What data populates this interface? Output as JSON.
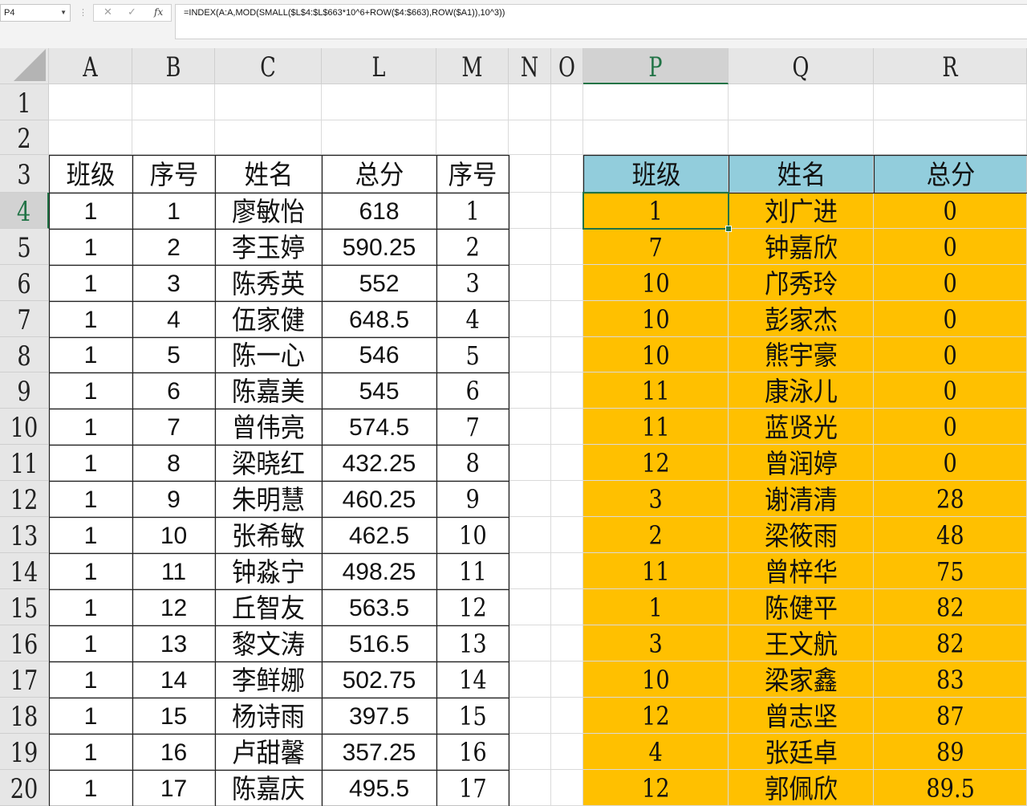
{
  "formula_bar": {
    "name_box": "P4",
    "cancel_icon": "✕",
    "enter_icon": "✓",
    "fx_label": "fx",
    "formula": "=INDEX(A:A,MOD(SMALL($L$4:$L$663*10^6+ROW($4:$663),ROW($A1)),10^3))"
  },
  "columns": [
    "A",
    "B",
    "C",
    "L",
    "M",
    "N",
    "O",
    "P",
    "Q",
    "R"
  ],
  "rows": [
    "1",
    "2",
    "3",
    "4",
    "5",
    "6",
    "7",
    "8",
    "9",
    "10",
    "11",
    "12",
    "13",
    "14",
    "15",
    "16",
    "17",
    "18",
    "19",
    "20"
  ],
  "selected_cell": "P4",
  "left_table": {
    "headers": [
      "班级",
      "序号",
      "姓名",
      "总分",
      "序号"
    ],
    "rows": [
      [
        "1",
        "1",
        "廖敏怡",
        "618",
        "1"
      ],
      [
        "1",
        "2",
        "李玉婷",
        "590.25",
        "2"
      ],
      [
        "1",
        "3",
        "陈秀英",
        "552",
        "3"
      ],
      [
        "1",
        "4",
        "伍家健",
        "648.5",
        "4"
      ],
      [
        "1",
        "5",
        "陈一心",
        "546",
        "5"
      ],
      [
        "1",
        "6",
        "陈嘉美",
        "545",
        "6"
      ],
      [
        "1",
        "7",
        "曾伟亮",
        "574.5",
        "7"
      ],
      [
        "1",
        "8",
        "梁晓红",
        "432.25",
        "8"
      ],
      [
        "1",
        "9",
        "朱明慧",
        "460.25",
        "9"
      ],
      [
        "1",
        "10",
        "张希敏",
        "462.5",
        "10"
      ],
      [
        "1",
        "11",
        "钟淼宁",
        "498.25",
        "11"
      ],
      [
        "1",
        "12",
        "丘智友",
        "563.5",
        "12"
      ],
      [
        "1",
        "13",
        "黎文涛",
        "516.5",
        "13"
      ],
      [
        "1",
        "14",
        "李鲜娜",
        "502.75",
        "14"
      ],
      [
        "1",
        "15",
        "杨诗雨",
        "397.5",
        "15"
      ],
      [
        "1",
        "16",
        "卢甜馨",
        "357.25",
        "16"
      ],
      [
        "1",
        "17",
        "陈嘉庆",
        "495.5",
        "17"
      ]
    ]
  },
  "right_table": {
    "header_bg": "#92CDDC",
    "body_bg": "#FFC000",
    "headers": [
      "班级",
      "姓名",
      "总分"
    ],
    "rows": [
      [
        "1",
        "刘广进",
        "0"
      ],
      [
        "7",
        "钟嘉欣",
        "0"
      ],
      [
        "10",
        "邝秀玲",
        "0"
      ],
      [
        "10",
        "彭家杰",
        "0"
      ],
      [
        "10",
        "熊宇豪",
        "0"
      ],
      [
        "11",
        "康泳儿",
        "0"
      ],
      [
        "11",
        "蓝贤光",
        "0"
      ],
      [
        "12",
        "曾润婷",
        "0"
      ],
      [
        "3",
        "谢清清",
        "28"
      ],
      [
        "2",
        "梁筱雨",
        "48"
      ],
      [
        "11",
        "曾梓华",
        "75"
      ],
      [
        "1",
        "陈健平",
        "82"
      ],
      [
        "3",
        "王文航",
        "82"
      ],
      [
        "10",
        "梁家鑫",
        "83"
      ],
      [
        "12",
        "曾志坚",
        "87"
      ],
      [
        "4",
        "张廷卓",
        "89"
      ],
      [
        "12",
        "郭佩欣",
        "89.5"
      ]
    ]
  }
}
